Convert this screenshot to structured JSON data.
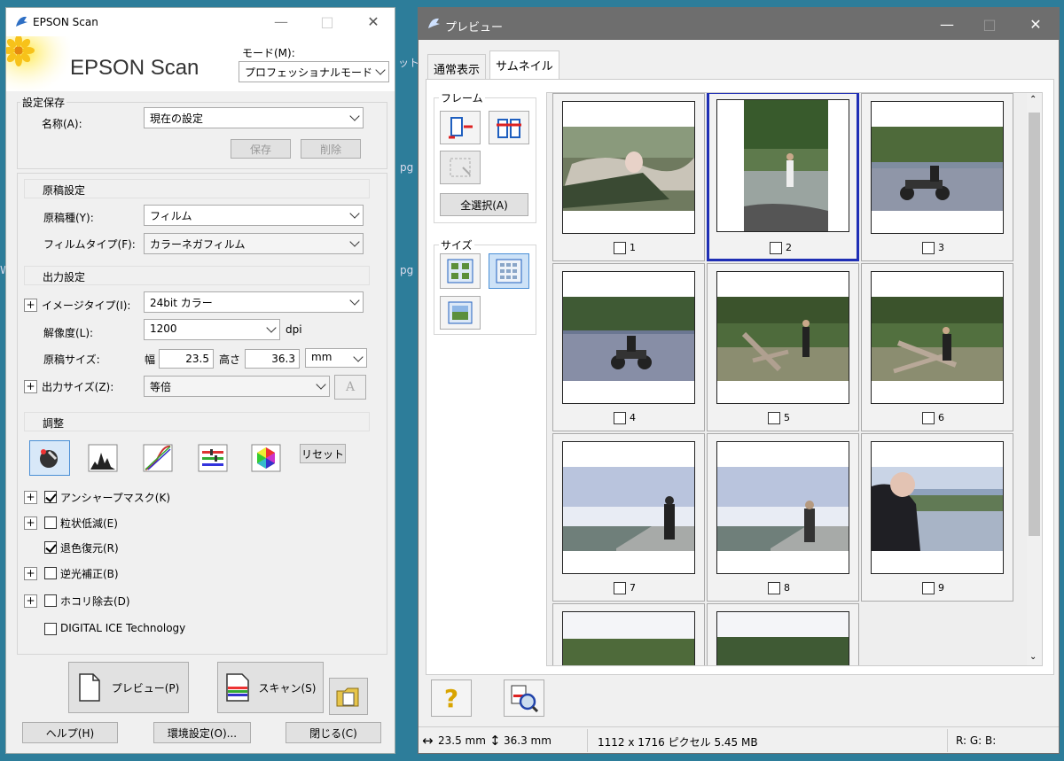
{
  "desktop": {
    "fragments": [
      "ット",
      "pg",
      "pg",
      "W"
    ]
  },
  "left_window": {
    "title": "EPSON Scan",
    "banner_title": "EPSON Scan",
    "mode": {
      "label": "モード(M):",
      "value": "プロフェッショナルモード"
    },
    "settings_save": {
      "group_label": "設定保存",
      "name_label": "名称(A):",
      "name_value": "現在の設定",
      "save_button": "保存",
      "delete_button": "削除"
    },
    "original": {
      "header": "原稿設定",
      "doc_type_label": "原稿種(Y):",
      "doc_type_value": "フィルム",
      "film_type_label": "フィルムタイプ(F):",
      "film_type_value": "カラーネガフィルム"
    },
    "output": {
      "header": "出力設定",
      "image_type_label": "イメージタイプ(I):",
      "image_type_value": "24bit カラー",
      "resolution_label": "解像度(L):",
      "resolution_value": "1200",
      "dpi_unit": "dpi",
      "size_label": "原稿サイズ:",
      "width_label": "幅",
      "width_value": "23.5",
      "height_label": "高さ",
      "height_value": "36.3",
      "unit_value": "mm",
      "output_size_label": "出力サイズ(Z):",
      "output_size_value": "等倍"
    },
    "adjust": {
      "header": "調整",
      "reset_button": "リセット",
      "tools": [
        "auto-exposure-icon",
        "histogram-icon",
        "tone-curve-icon",
        "color-balance-icon",
        "color-palette-icon"
      ],
      "options": [
        {
          "label": "アンシャープマスク(K)",
          "checked": true,
          "expandable": true
        },
        {
          "label": "粒状低減(E)",
          "checked": false,
          "expandable": true
        },
        {
          "label": "退色復元(R)",
          "checked": true,
          "expandable": false
        },
        {
          "label": "逆光補正(B)",
          "checked": false,
          "expandable": true
        },
        {
          "label": "ホコリ除去(D)",
          "checked": false,
          "expandable": true
        },
        {
          "label": "DIGITAL ICE Technology",
          "checked": false,
          "expandable": false
        }
      ]
    },
    "preview_button": "プレビュー(P)",
    "scan_button": "スキャン(S)",
    "help_button": "ヘルプ(H)",
    "config_button": "環境設定(O)...",
    "close_button": "閉じる(C)"
  },
  "right_window": {
    "title": "プレビュー",
    "tabs": [
      "通常表示",
      "サムネイル"
    ],
    "active_tab": "サムネイル",
    "frame_group": {
      "label": "フレーム",
      "select_all_button": "全選択(A)"
    },
    "size_group": {
      "label": "サイズ"
    },
    "thumbnails": [
      {
        "number": "1",
        "selected": false,
        "checked": false
      },
      {
        "number": "2",
        "selected": true,
        "checked": false
      },
      {
        "number": "3",
        "selected": false,
        "checked": false
      },
      {
        "number": "4",
        "selected": false,
        "checked": false
      },
      {
        "number": "5",
        "selected": false,
        "checked": false
      },
      {
        "number": "6",
        "selected": false,
        "checked": false
      },
      {
        "number": "7",
        "selected": false,
        "checked": false
      },
      {
        "number": "8",
        "selected": false,
        "checked": false
      },
      {
        "number": "9",
        "selected": false,
        "checked": false
      }
    ],
    "status": {
      "width": "23.5 mm",
      "height": "36.3 mm",
      "pixels": "1112 x 1716 ピクセル 5.45 MB",
      "rgb": "R: G: B:"
    }
  }
}
